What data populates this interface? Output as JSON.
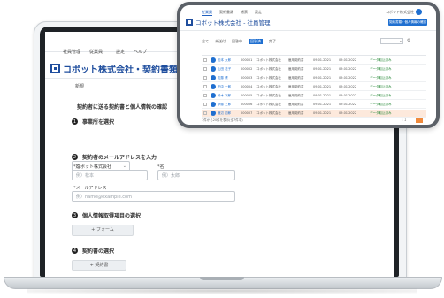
{
  "main": {
    "nav": [
      "社員管理",
      "従業員",
      "設定",
      "ヘルプ"
    ],
    "brand": "コボット株式会社・契約書類を送",
    "side_button": "新規",
    "section_title": "契約者に送る契約書と個人情報の確認",
    "steps": [
      "事業所を選択",
      "契約者のメールアドレスを入力",
      "個人情報取得項目の選択",
      "契約書の選択"
    ],
    "office_select": "コボット株式会社",
    "last_name_label": "*姓",
    "last_name_placeholder": "例）松本",
    "first_name_label": "*名",
    "first_name_placeholder": "例）太郎",
    "email_label": "*メールアドレス",
    "email_placeholder": "例）name@example.com",
    "add_form_button": "+ フォーム",
    "add_contract_button": "+ 契約書"
  },
  "popup": {
    "tabs": [
      "従業員",
      "契約書類",
      "帳票",
      "設定"
    ],
    "user": "コボット株式会社",
    "brand": "コボット株式会社 - 社員管理",
    "cta": "契約書類・個人情報の確認",
    "filters": [
      "全て",
      "未送付",
      "回答中",
      "回答済",
      "完了"
    ],
    "active_filter_index": 3,
    "rows": [
      {
        "name": "松本 太郎",
        "no": "000001",
        "company": "コボット株式会社",
        "type": "雇用契約書",
        "date1": "09.01.2021",
        "date2": "09.01.2022",
        "status": "データ取込済み"
      },
      {
        "name": "山田 花子",
        "no": "000002",
        "company": "コボット株式会社",
        "type": "雇用契約書",
        "date1": "09.01.2021",
        "date2": "09.01.2022",
        "status": "データ取込済み"
      },
      {
        "name": "佐藤 健",
        "no": "000003",
        "company": "コボット株式会社",
        "type": "雇用契約書",
        "date1": "09.01.2021",
        "date2": "09.01.2022",
        "status": "データ取込済み"
      },
      {
        "name": "田中 一郎",
        "no": "000004",
        "company": "コボット株式会社",
        "type": "雇用契約書",
        "date1": "09.01.2021",
        "date2": "09.01.2022",
        "status": "データ取込済み"
      },
      {
        "name": "鈴木 次郎",
        "no": "000005",
        "company": "コボット株式会社",
        "type": "雇用契約書",
        "date1": "09.01.2021",
        "date2": "09.01.2022",
        "status": "データ取込済み"
      },
      {
        "name": "伊藤 三郎",
        "no": "000006",
        "company": "コボット株式会社",
        "type": "雇用契約書",
        "date1": "09.01.2021",
        "date2": "09.01.2022",
        "status": "データ取込済み"
      },
      {
        "name": "渡辺 四郎",
        "no": "000007",
        "company": "コボット株式会社",
        "type": "雇用契約書",
        "date1": "09.01.2021",
        "date2": "09.01.2022",
        "status": "データ取込済み"
      }
    ],
    "highlight_row_index": 6,
    "footer": "1件から20件を表示(全7件中)",
    "pager_prev": "‹ 1",
    "accent_color": "#1f6fd0",
    "highlight_color": "#fde9dc"
  }
}
